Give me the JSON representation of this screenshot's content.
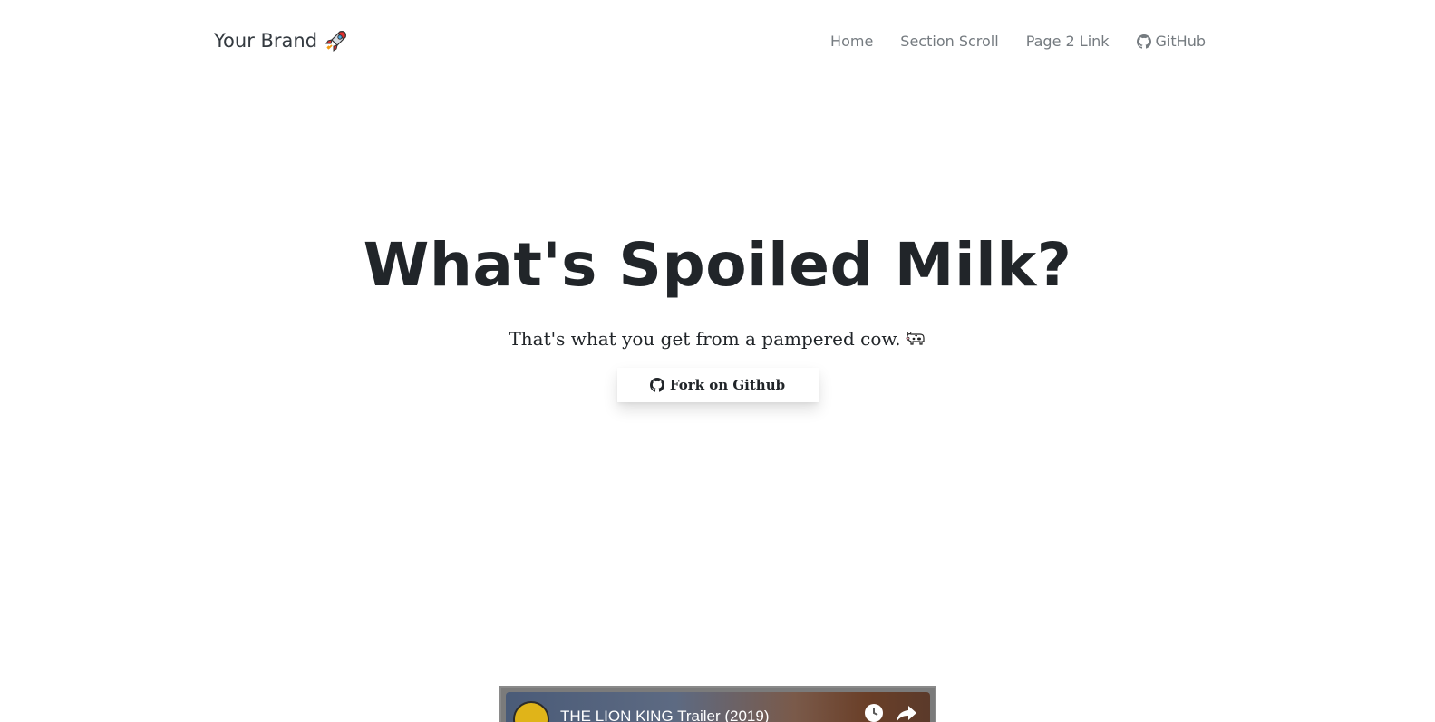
{
  "navbar": {
    "brand": "Your Brand",
    "brand_icon": "rocket-icon",
    "links": [
      {
        "label": "Home"
      },
      {
        "label": "Section Scroll"
      },
      {
        "label": "Page 2 Link"
      },
      {
        "label": "GitHub",
        "icon": "github-icon"
      }
    ]
  },
  "hero": {
    "title": "What's Spoiled Milk?",
    "subtitle": "That's what you get from a pampered cow.",
    "subtitle_icon": "cow-icon",
    "button_label": "Fork on Github",
    "button_icon": "github-icon"
  },
  "video": {
    "title": "THE LION KING Trailer (2019)",
    "icons": [
      "watch-later-icon",
      "share-icon"
    ]
  }
}
